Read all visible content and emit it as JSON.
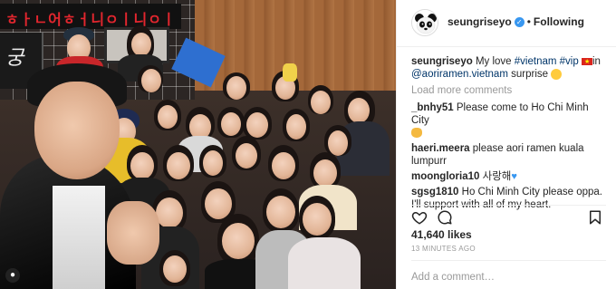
{
  "post": {
    "photo_alt_banner": "ㅎㅏㄴ어ㅎㅓ니ㅇㅣ니ㅇㅣ",
    "sign_text": "궁",
    "icon_corner": "camera-icon"
  },
  "header": {
    "username": "seungriseyo",
    "verified_icon": "verified-badge-icon",
    "separator": "•",
    "follow_state": "Following"
  },
  "caption": {
    "username": "seungriseyo",
    "text_before": "My love",
    "tag1": "#vietnam",
    "tag2": "#vip",
    "text_in": "in",
    "mention": "@aoriramen.vietnam",
    "text_after": "surprise"
  },
  "load_more": "Load more comments",
  "comments": [
    {
      "username": "_bnhy51",
      "text": "Please come to Ho Chi Minh City"
    },
    {
      "username": "haeri.meera",
      "text": "please aori ramen kuala lumpurr"
    },
    {
      "username": "moongloria10",
      "text": "사랑해"
    },
    {
      "username": "sgsg1810",
      "text": "Ho Chi Minh City please oppa. I'll support with all of my heart."
    }
  ],
  "likes": "41,640 likes",
  "time": "13 MINUTES AGO",
  "add_comment_placeholder": "Add a comment…",
  "colors": {
    "link": "#003569",
    "muted": "#999999",
    "verified": "#3897f0"
  }
}
